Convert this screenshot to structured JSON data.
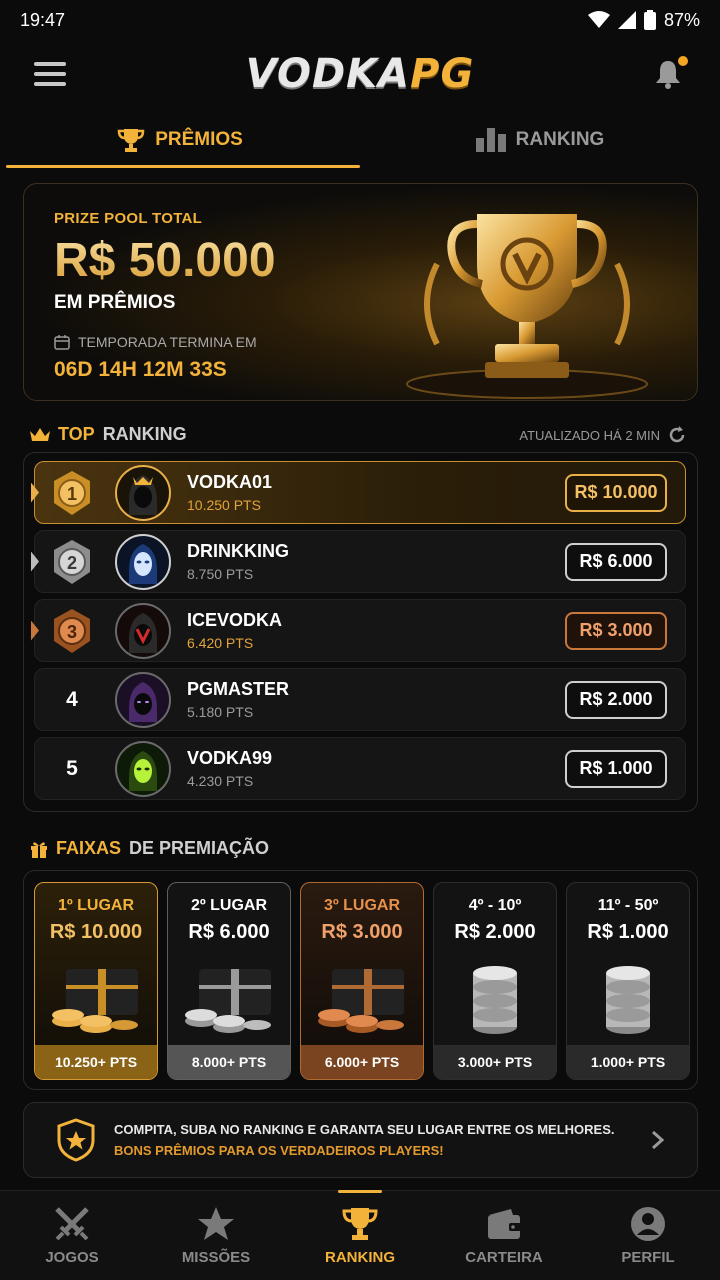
{
  "status": {
    "time": "19:47",
    "battery": "87%"
  },
  "header": {
    "logo_part1": "VODKA",
    "logo_part2": "PG"
  },
  "tabs": [
    {
      "label": "PRÊMIOS",
      "icon": "trophy-icon",
      "active": true
    },
    {
      "label": "RANKING",
      "icon": "bar-chart-icon",
      "active": false
    }
  ],
  "hero": {
    "pool_label": "PRIZE POOL TOTAL",
    "pool_value": "R$ 50.000",
    "pool_sub": "EM PRÊMIOS",
    "season_label": "TEMPORADA TERMINA EM",
    "countdown": "06D 14H 12M 33S"
  },
  "ranking_section": {
    "title_gold": "TOP",
    "title_rest": "RANKING",
    "updated": "ATUALIZADO HÁ 2 MIN",
    "players": [
      {
        "pos": "1",
        "name": "VODKA01",
        "pts": "10.250 PTS",
        "prize": "R$ 10.000"
      },
      {
        "pos": "2",
        "name": "DRINKKING",
        "pts": "8.750 PTS",
        "prize": "R$ 6.000"
      },
      {
        "pos": "3",
        "name": "ICEVODKA",
        "pts": "6.420 PTS",
        "prize": "R$ 3.000"
      },
      {
        "pos": "4",
        "name": "PGMASTER",
        "pts": "5.180 PTS",
        "prize": "R$ 2.000"
      },
      {
        "pos": "5",
        "name": "VODKA99",
        "pts": "4.230 PTS",
        "prize": "R$ 1.000"
      }
    ]
  },
  "tiers_section": {
    "title_gold": "FAIXAS",
    "title_rest": "DE PREMIAÇÃO",
    "tiers": [
      {
        "label": "1º LUGAR",
        "value": "R$ 10.000",
        "pts": "10.250+ PTS"
      },
      {
        "label": "2º LUGAR",
        "value": "R$ 6.000",
        "pts": "8.000+ PTS"
      },
      {
        "label": "3º LUGAR",
        "value": "R$ 3.000",
        "pts": "6.000+ PTS"
      },
      {
        "label": "4º - 10º",
        "value": "R$ 2.000",
        "pts": "3.000+ PTS"
      },
      {
        "label": "11º - 50º",
        "value": "R$ 1.000",
        "pts": "1.000+ PTS"
      }
    ]
  },
  "promo": {
    "line1": "COMPITA, SUBA NO RANKING E GARANTA SEU LUGAR ENTRE OS MELHORES.",
    "line2": "BONS PRÊMIOS PARA OS VERDADEIROS PLAYERS!"
  },
  "bottom_nav": [
    {
      "label": "JOGOS",
      "icon": "crossed-swords-icon"
    },
    {
      "label": "MISSÕES",
      "icon": "star-icon"
    },
    {
      "label": "RANKING",
      "icon": "trophy-icon",
      "active": true
    },
    {
      "label": "CARTEIRA",
      "icon": "wallet-icon"
    },
    {
      "label": "PERFIL",
      "icon": "user-icon"
    }
  ],
  "colors": {
    "accent": "#f3b33a",
    "background": "#0b0b0c",
    "silver": "#cfcfcf",
    "bronze": "#c9773a"
  }
}
